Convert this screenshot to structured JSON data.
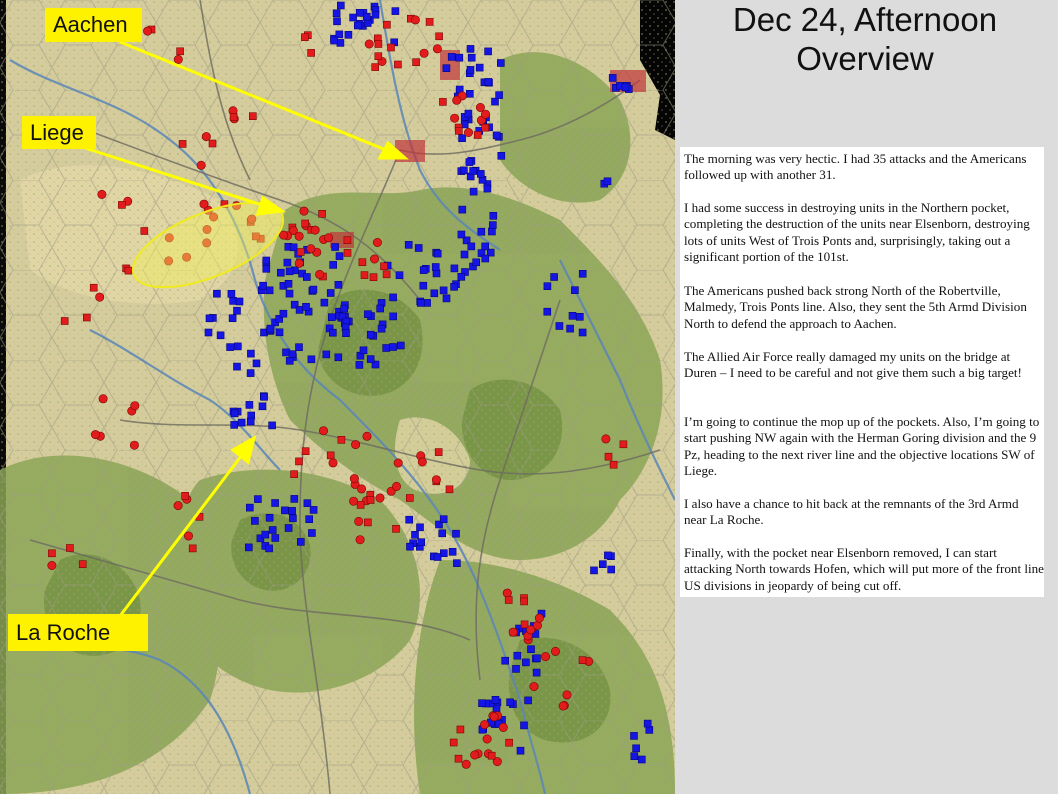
{
  "title": {
    "line1": "Dec 24, Afternoon",
    "line2": "Overview"
  },
  "paragraphs": [
    "The morning was very hectic.  I had 35 attacks and the Americans followed up with another 31.",
    "I had some success in destroying units in the Northern pocket, completing the destruction of the units near Elsenborn, destroying lots of units West of Trois Ponts and, surprisingly, taking out a significant portion of the 101st.",
    "The Americans pushed back strong North of the Robertville, Malmedy, Trois Ponts line.  Also, they sent the 5th Armd Division North to defend the approach to Aachen.",
    "The Allied Air Force really damaged my units on the bridge at Duren – I need to be careful and not give them such a big target!",
    "I’m going to continue the mop up of the pockets.  Also, I’m going to start pushing NW again with the Herman Goring division and the 9 Pz, heading to the next river line and the objective locations SW of Liege.",
    "I also have a chance to hit back at the remnants of the 3rd Armd near La Roche.",
    "Finally, with the pocket near Elsenborn removed, I can start attacking North towards Hofen, which will put more of the front line US divisions in jeopardy of being cut off."
  ],
  "map_labels": {
    "aachen": "Aachen",
    "liege": "Liege",
    "la_roche": "La Roche"
  },
  "colors": {
    "background": "#dcdcdc",
    "label_fill": "#fff200",
    "arrow": "#ffff00",
    "german_units": "#e01010",
    "us_units": "#1010e0",
    "terrain": "#d2c99a",
    "forest": "#7e9a4a"
  }
}
